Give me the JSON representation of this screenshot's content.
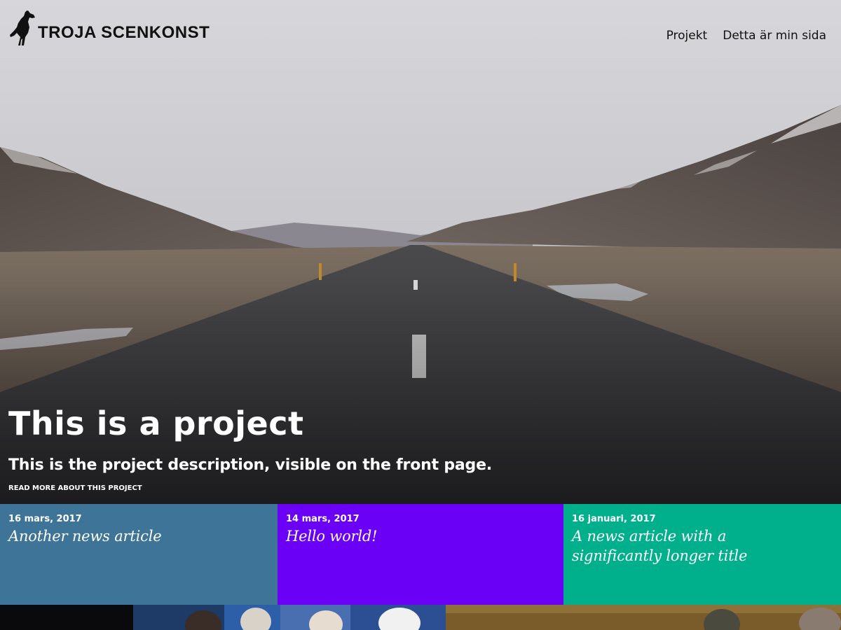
{
  "site": {
    "logo_text": "TROJA SCENKONST"
  },
  "nav": {
    "items": [
      {
        "label": "Projekt"
      },
      {
        "label": "Detta är min sida"
      }
    ]
  },
  "hero": {
    "title": "This is a project",
    "description": "This is the project description, visible on the front page.",
    "link_label": "READ MORE ABOUT THIS PROJECT"
  },
  "news": [
    {
      "date": "16 mars, 2017",
      "title": "Another news article",
      "color": "#3E7498"
    },
    {
      "date": "14 mars, 2017",
      "title": "Hello world!",
      "color": "#6B00F7"
    },
    {
      "date": "16 januari, 2017",
      "title": "A news article with a significantly longer title",
      "color": "#00AF8C"
    }
  ],
  "colors": {
    "text_on_tiles": "#FFFFFF",
    "nav_text": "#111111"
  },
  "icons": {
    "logo": "rearing-horse-icon"
  }
}
